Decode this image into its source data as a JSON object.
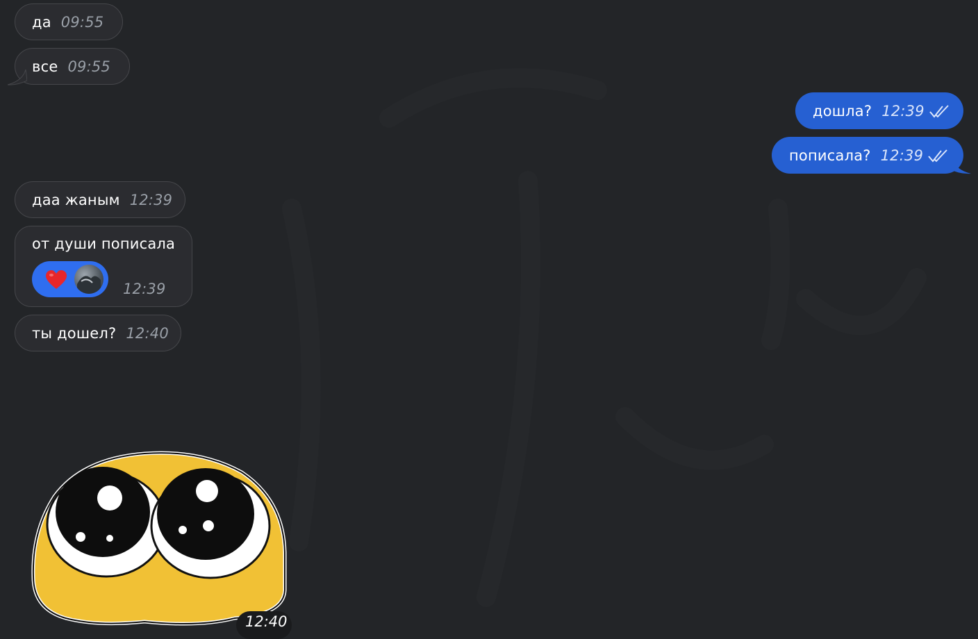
{
  "colors": {
    "background": "#232528",
    "incoming_bubble": "#2b2c30",
    "outgoing_bubble": "#2660d2",
    "reaction_pill": "#2f6ef0"
  },
  "messages": [
    {
      "direction": "incoming",
      "text": "да",
      "time": "09:55"
    },
    {
      "direction": "incoming",
      "text": "все",
      "time": "09:55"
    },
    {
      "direction": "outgoing",
      "text": "дошла?",
      "time": "12:39",
      "status": "read"
    },
    {
      "direction": "outgoing",
      "text": "пописала?",
      "time": "12:39",
      "status": "read"
    },
    {
      "direction": "incoming",
      "text": "даа жаным",
      "time": "12:39"
    },
    {
      "direction": "incoming",
      "text": "от души пописала",
      "time": "12:39",
      "reaction": {
        "emoji": "heart-icon",
        "reactor": "avatar"
      }
    },
    {
      "direction": "incoming",
      "text": "ты дошел?",
      "time": "12:40"
    },
    {
      "direction": "incoming",
      "type": "sticker",
      "sticker": "cute-pleading-face-sticker",
      "time": "12:40"
    }
  ]
}
